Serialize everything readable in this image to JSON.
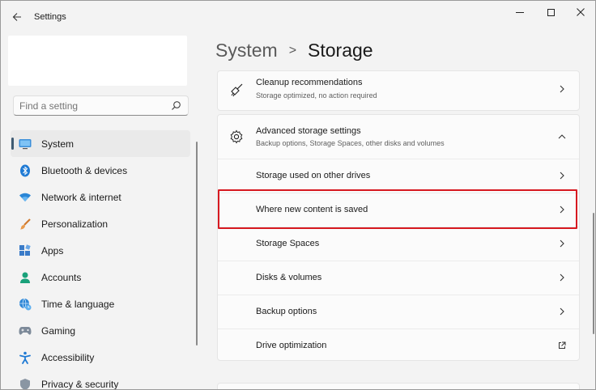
{
  "window": {
    "app_title": "Settings",
    "back_icon": "arrow-left-icon",
    "minimize_icon": "minimize-icon",
    "maximize_icon": "maximize-icon",
    "close_icon": "close-icon"
  },
  "search": {
    "placeholder": "Find a setting",
    "icon": "search-icon"
  },
  "sidebar": {
    "items": [
      {
        "label": "System",
        "icon": "monitor-icon",
        "active": true
      },
      {
        "label": "Bluetooth & devices",
        "icon": "bluetooth-icon"
      },
      {
        "label": "Network & internet",
        "icon": "wifi-icon"
      },
      {
        "label": "Personalization",
        "icon": "brush-icon"
      },
      {
        "label": "Apps",
        "icon": "apps-icon"
      },
      {
        "label": "Accounts",
        "icon": "person-icon"
      },
      {
        "label": "Time & language",
        "icon": "globe-clock-icon"
      },
      {
        "label": "Gaming",
        "icon": "gamepad-icon"
      },
      {
        "label": "Accessibility",
        "icon": "accessibility-icon"
      },
      {
        "label": "Privacy & security",
        "icon": "shield-icon"
      }
    ]
  },
  "breadcrumb": {
    "parent": "System",
    "separator": ">",
    "current": "Storage"
  },
  "main": {
    "cleanup": {
      "title": "Cleanup recommendations",
      "subtitle": "Storage optimized, no action required",
      "icon": "broom-icon"
    },
    "advanced": {
      "title": "Advanced storage settings",
      "subtitle": "Backup options, Storage Spaces, other disks and volumes",
      "icon": "gear-icon",
      "expanded": true,
      "items": [
        {
          "label": "Storage used on other drives",
          "action": "chevron-right-icon"
        },
        {
          "label": "Where new content is saved",
          "action": "chevron-right-icon",
          "highlighted": true
        },
        {
          "label": "Storage Spaces",
          "action": "chevron-right-icon"
        },
        {
          "label": "Disks & volumes",
          "action": "chevron-right-icon"
        },
        {
          "label": "Backup options",
          "action": "chevron-right-icon"
        },
        {
          "label": "Drive optimization",
          "action": "external-link-icon"
        }
      ]
    }
  },
  "colors": {
    "accent": "#3f5b73",
    "highlight_border": "#d71920",
    "background": "#f3f3f3",
    "card": "#fbfbfb"
  }
}
